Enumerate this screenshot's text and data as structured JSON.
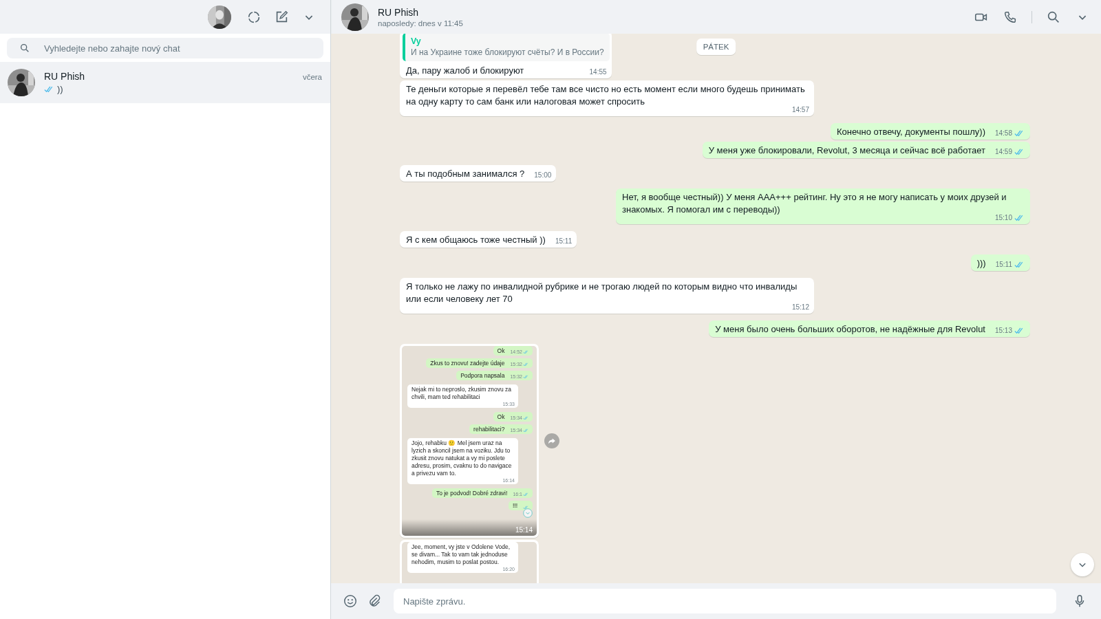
{
  "sidebar": {
    "search": {
      "placeholder": "Vyhledejte nebo zahajte nový chat"
    },
    "chats": [
      {
        "name": "RU Phish",
        "time": "včera",
        "preview": "))",
        "read": true,
        "selected": true
      }
    ]
  },
  "chat": {
    "name": "RU Phish",
    "status": "naposledy: dnes v 11:45",
    "day_label": "PÁTEK",
    "messages": [
      {
        "kind": "text",
        "outgoing": false,
        "quote": {
          "author": "Vy",
          "text": "И на Украине тоже блокируют счёты? И в России?"
        },
        "text": "Да, пару жалоб и блокируют",
        "time": "14:55"
      },
      {
        "kind": "text",
        "outgoing": false,
        "text": "Те деньги которые я перевёл тебе там все чисто но есть момент если много будешь принимать на одну карту то сам банк или налоговая может спросить",
        "time": "14:57"
      },
      {
        "kind": "text",
        "outgoing": true,
        "text": "Конечно отвечу, документы пошлу))",
        "time": "14:58",
        "read": true
      },
      {
        "kind": "text",
        "outgoing": true,
        "text": "У меня уже блокировали, Revolut, 3 месяца и сейчас всё работает",
        "time": "14:59",
        "read": true
      },
      {
        "kind": "text",
        "outgoing": false,
        "text": "А ты подобным занимался ?",
        "time": "15:00"
      },
      {
        "kind": "text",
        "outgoing": true,
        "text": "Нет, я вообще честный)) У меня AAA+++ рейтинг. Ну это я не могу написать у моих друзей и знакомых. Я помогал им с переводы))",
        "time": "15:10",
        "read": true
      },
      {
        "kind": "text",
        "outgoing": false,
        "text": "Я с кем общаюсь тоже честный ))",
        "time": "15:11"
      },
      {
        "kind": "text",
        "outgoing": true,
        "text": ")))",
        "time": "15:11",
        "read": true
      },
      {
        "kind": "text",
        "outgoing": false,
        "text": "Я только не лажу по инвалидной рубрике и не трогаю людей по которым видно что инвалиды или если человеку лет 70",
        "time": "15:12"
      },
      {
        "kind": "text",
        "outgoing": true,
        "text": "У меня было очень больших оборотов, не надёжные для Revolut",
        "time": "15:13",
        "read": true
      },
      {
        "kind": "screenshot",
        "outgoing": false,
        "time": "15:14",
        "forward": true,
        "messages": [
          {
            "kind": "text",
            "outgoing": true,
            "text": "Ok",
            "time": "14:52",
            "read": true
          },
          {
            "kind": "text",
            "outgoing": true,
            "text": "Zkus to znovu!  zadejte údaje",
            "time": "15:32",
            "read": true
          },
          {
            "kind": "text",
            "outgoing": true,
            "text": "Podpora napsala",
            "time": "15:32",
            "read": true
          },
          {
            "kind": "text",
            "outgoing": false,
            "text": "Nejak mi to neproslo, zkusim znovu za chvili, mam ted rehabilitaci",
            "time": "15:33"
          },
          {
            "kind": "text",
            "outgoing": true,
            "text": "Ok",
            "time": "15:34",
            "read": true
          },
          {
            "kind": "text",
            "outgoing": true,
            "text": "rehabilitaci?",
            "time": "15:34",
            "read": true
          },
          {
            "kind": "text",
            "outgoing": false,
            "text": "Jojo, rehabku 🙂 Mel jsem uraz na lyzich a skoncil jsem na voziku. Jdu to zkusit znovu natukat a vy mi poslete adresu, prosim, cvaknu to do navigace a privezu vam to.",
            "time": "16:14"
          },
          {
            "kind": "text",
            "outgoing": true,
            "text": "To je podvod!  Dobré zdravi!",
            "time": "16:1",
            "read": true
          },
          {
            "kind": "text",
            "outgoing": true,
            "text": "!!!",
            "read": true
          }
        ]
      },
      {
        "kind": "screenshot",
        "outgoing": false,
        "messages": [
          {
            "kind": "text",
            "outgoing": false,
            "text": "Jee, moment, vy jste v Odolene Vode, se divam... Tak to vam tak jednoduse nehodim, musim to poslat postou.",
            "time": "16:20"
          }
        ]
      }
    ]
  },
  "composer": {
    "placeholder": "Napište zprávu."
  }
}
